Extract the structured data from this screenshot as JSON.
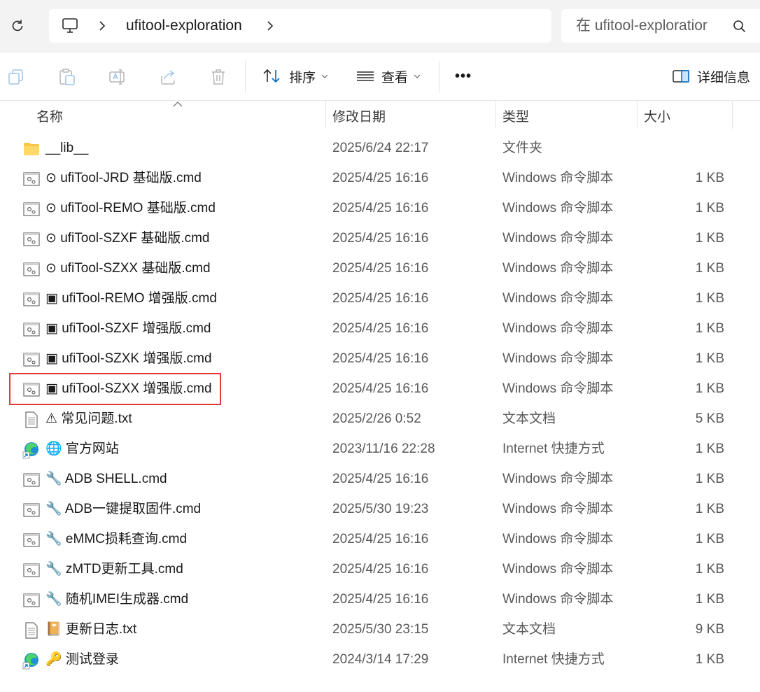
{
  "address_bar": {
    "refresh_icon": "refresh-icon",
    "computer_icon": "computer-icon",
    "breadcrumb": [
      "ufitool-exploration"
    ],
    "search_placeholder": "在 ufitool-exploratior"
  },
  "command_bar": {
    "copy_icon": "copy-icon",
    "paste_icon": "paste-icon",
    "rename_icon": "rename-icon",
    "share_icon": "share-icon",
    "delete_icon": "trash-icon",
    "sort_label": "排序",
    "view_label": "查看",
    "more_label": "•••",
    "details_label": "详细信息"
  },
  "columns": {
    "name": "名称",
    "modified": "修改日期",
    "type": "类型",
    "size": "大小"
  },
  "files": [
    {
      "name": "__lib__",
      "date": "2025/6/24 22:17",
      "type": "文件夹",
      "size": "",
      "icon": "folder-icon"
    },
    {
      "name": "⊙ ufiTool-JRD 基础版.cmd",
      "date": "2025/4/25 16:16",
      "type": "Windows 命令脚本",
      "size": "1 KB",
      "icon": "cmd-file-icon"
    },
    {
      "name": "⊙ ufiTool-REMO 基础版.cmd",
      "date": "2025/4/25 16:16",
      "type": "Windows 命令脚本",
      "size": "1 KB",
      "icon": "cmd-file-icon"
    },
    {
      "name": "⊙ ufiTool-SZXF 基础版.cmd",
      "date": "2025/4/25 16:16",
      "type": "Windows 命令脚本",
      "size": "1 KB",
      "icon": "cmd-file-icon"
    },
    {
      "name": "⊙ ufiTool-SZXX 基础版.cmd",
      "date": "2025/4/25 16:16",
      "type": "Windows 命令脚本",
      "size": "1 KB",
      "icon": "cmd-file-icon"
    },
    {
      "name": "▣ ufiTool-REMO 增强版.cmd",
      "date": "2025/4/25 16:16",
      "type": "Windows 命令脚本",
      "size": "1 KB",
      "icon": "cmd-file-icon"
    },
    {
      "name": "▣ ufiTool-SZXF 增强版.cmd",
      "date": "2025/4/25 16:16",
      "type": "Windows 命令脚本",
      "size": "1 KB",
      "icon": "cmd-file-icon"
    },
    {
      "name": "▣ ufiTool-SZXK 增强版.cmd",
      "date": "2025/4/25 16:16",
      "type": "Windows 命令脚本",
      "size": "1 KB",
      "icon": "cmd-file-icon"
    },
    {
      "name": "▣ ufiTool-SZXX 增强版.cmd",
      "date": "2025/4/25 16:16",
      "type": "Windows 命令脚本",
      "size": "1 KB",
      "icon": "cmd-file-icon"
    },
    {
      "name": "⚠ 常见问题.txt",
      "date": "2025/2/26 0:52",
      "type": "文本文档",
      "size": "5 KB",
      "icon": "text-file-icon"
    },
    {
      "name": "🌐 官方网站",
      "date": "2023/11/16 22:28",
      "type": "Internet 快捷方式",
      "size": "1 KB",
      "icon": "edge-shortcut-icon"
    },
    {
      "name": "🔧 ADB SHELL.cmd",
      "date": "2025/4/25 16:16",
      "type": "Windows 命令脚本",
      "size": "1 KB",
      "icon": "cmd-file-icon"
    },
    {
      "name": "🔧 ADB一键提取固件.cmd",
      "date": "2025/5/30 19:23",
      "type": "Windows 命令脚本",
      "size": "1 KB",
      "icon": "cmd-file-icon"
    },
    {
      "name": "🔧 eMMC损耗查询.cmd",
      "date": "2025/4/25 16:16",
      "type": "Windows 命令脚本",
      "size": "1 KB",
      "icon": "cmd-file-icon"
    },
    {
      "name": "🔧 zMTD更新工具.cmd",
      "date": "2025/4/25 16:16",
      "type": "Windows 命令脚本",
      "size": "1 KB",
      "icon": "cmd-file-icon"
    },
    {
      "name": "🔧 随机IMEI生成器.cmd",
      "date": "2025/4/25 16:16",
      "type": "Windows 命令脚本",
      "size": "1 KB",
      "icon": "cmd-file-icon"
    },
    {
      "name": "📔 更新日志.txt",
      "date": "2025/5/30 23:15",
      "type": "文本文档",
      "size": "9 KB",
      "icon": "text-file-icon"
    },
    {
      "name": "🔑 测试登录",
      "date": "2024/3/14 17:29",
      "type": "Internet 快捷方式",
      "size": "1 KB",
      "icon": "edge-shortcut-icon"
    }
  ],
  "colors": {
    "highlight": "#e03b3b",
    "folder": "#f8c74a",
    "accent": "#0067c0"
  }
}
